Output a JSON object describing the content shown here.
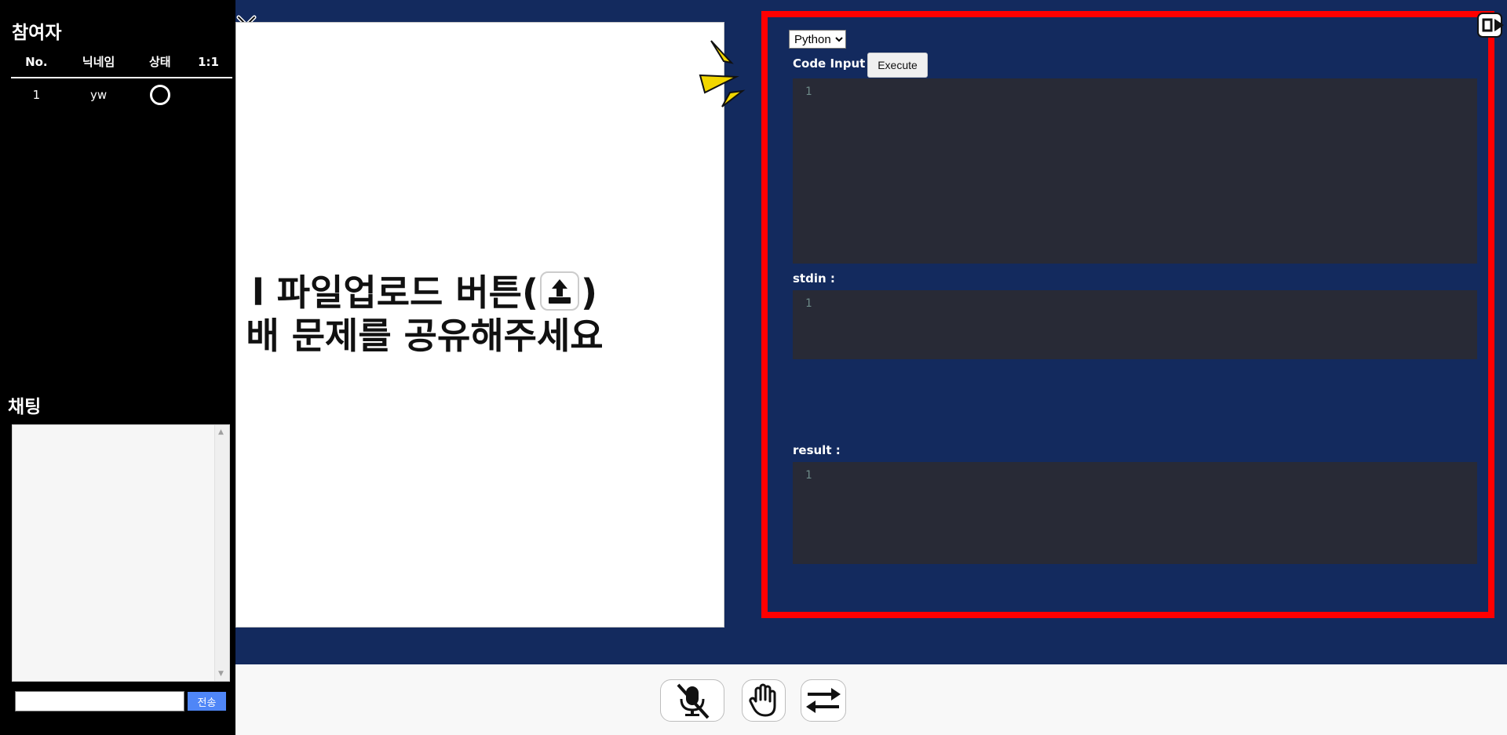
{
  "sidebar": {
    "participants_title": "참여자",
    "table": {
      "columns": [
        "No.",
        "닉네임",
        "상태",
        "1:1"
      ],
      "rows": [
        {
          "no": "1",
          "nickname": "yw",
          "status": "circle",
          "one_to_one": ""
        }
      ]
    },
    "chat_title": "채팅",
    "chat_input_value": "",
    "send_label": "전송"
  },
  "whiteboard": {
    "message_line1": "l 파일업로드 버튼(",
    "message_line1_end": ")",
    "message_line2": "배 문제를 공유해주세요"
  },
  "code_panel": {
    "language": "Python",
    "code_input_label": "Code Input",
    "execute_label": "Execute",
    "stdin_label": "stdin :",
    "result_label": "result :",
    "line_number": "1"
  },
  "toolbar": {
    "icons": [
      "mic-off-icon",
      "raise-hand-icon",
      "swap-icon"
    ]
  },
  "colors": {
    "background": "#132a5e",
    "highlight_border": "#ff0000",
    "editor_bg": "#282a36",
    "send_button": "#4f86f7"
  }
}
